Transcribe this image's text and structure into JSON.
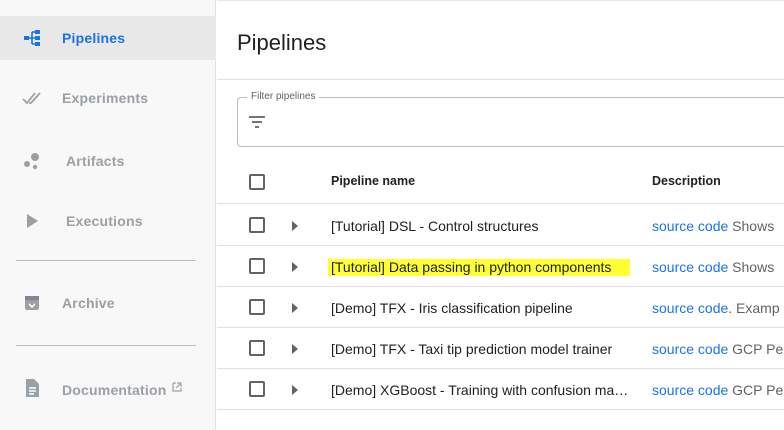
{
  "sidebar": {
    "items": [
      {
        "label": "Pipelines",
        "icon": "pipelines-icon"
      },
      {
        "label": "Experiments",
        "icon": "experiments-icon"
      },
      {
        "label": "Artifacts",
        "icon": "artifacts-icon"
      },
      {
        "label": "Executions",
        "icon": "executions-icon"
      },
      {
        "label": "Archive",
        "icon": "archive-icon"
      },
      {
        "label": "Documentation",
        "icon": "documentation-icon"
      }
    ]
  },
  "main": {
    "title": "Pipelines",
    "filter": {
      "label": "Filter pipelines",
      "value": ""
    },
    "table": {
      "headers": {
        "name": "Pipeline name",
        "description": "Description"
      },
      "rows": [
        {
          "name": "[Tutorial] DSL - Control structures",
          "desc_link": "source code",
          "desc_text": " Shows"
        },
        {
          "name": "[Tutorial] Data passing in python components",
          "desc_link": "source code",
          "desc_text": " Shows"
        },
        {
          "name": "[Demo] TFX - Iris classification pipeline",
          "desc_link": "source code",
          "desc_text": ". Examp"
        },
        {
          "name": "[Demo] TFX - Taxi tip prediction model trainer",
          "desc_link": "source code",
          "desc_text": " GCP Pe"
        },
        {
          "name": "[Demo] XGBoost - Training with confusion matrix",
          "desc_link": "source code",
          "desc_text": " GCP Pe"
        }
      ]
    }
  },
  "colors": {
    "accent": "#1a73e8",
    "highlight": "#ffff33",
    "sidebar_bg": "#f8f8f8"
  }
}
